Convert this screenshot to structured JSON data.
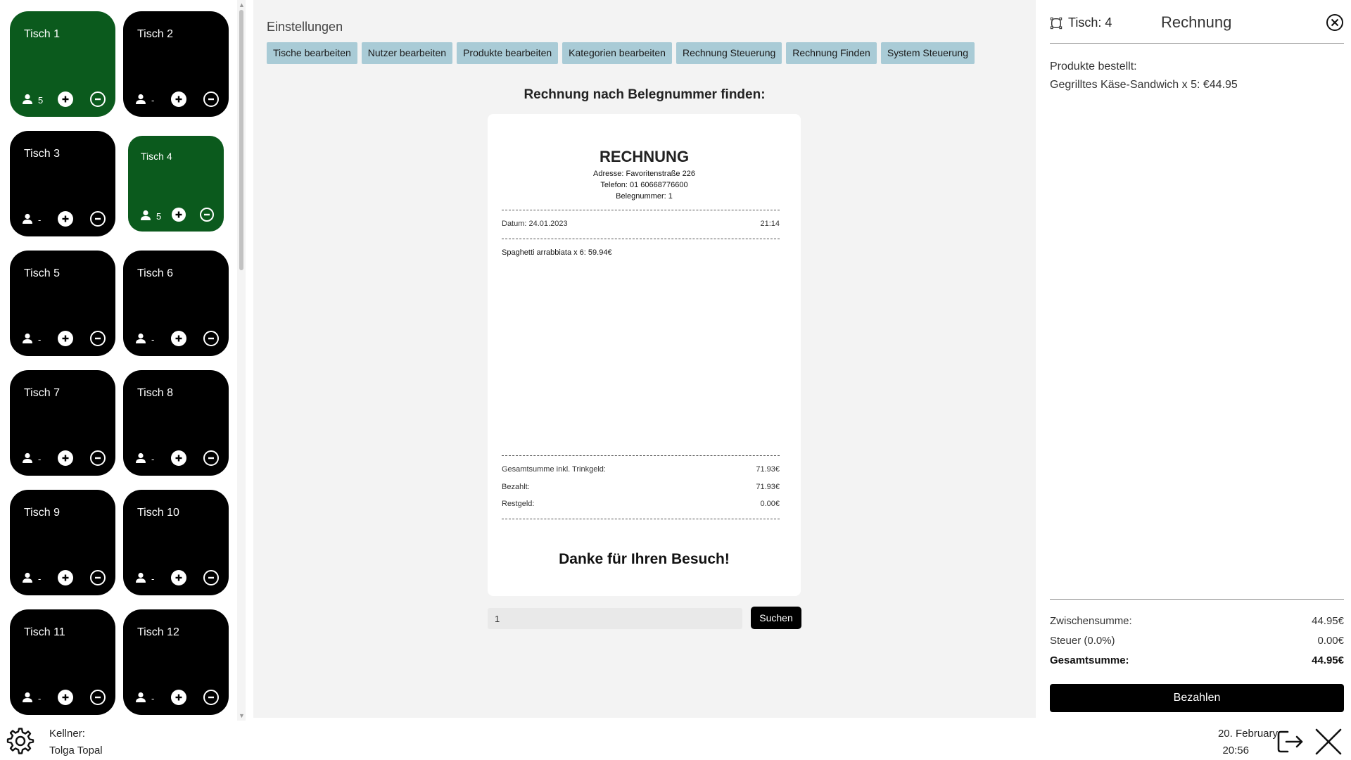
{
  "tables": [
    {
      "name": "Tisch 1",
      "guests": "5",
      "active": true,
      "selected": false
    },
    {
      "name": "Tisch 2",
      "guests": "-",
      "active": false,
      "selected": false
    },
    {
      "name": "Tisch 3",
      "guests": "-",
      "active": false,
      "selected": false
    },
    {
      "name": "Tisch 4",
      "guests": "5",
      "active": true,
      "selected": true
    },
    {
      "name": "Tisch 5",
      "guests": "-",
      "active": false,
      "selected": false
    },
    {
      "name": "Tisch 6",
      "guests": "-",
      "active": false,
      "selected": false
    },
    {
      "name": "Tisch 7",
      "guests": "-",
      "active": false,
      "selected": false
    },
    {
      "name": "Tisch 8",
      "guests": "-",
      "active": false,
      "selected": false
    },
    {
      "name": "Tisch 9",
      "guests": "-",
      "active": false,
      "selected": false
    },
    {
      "name": "Tisch 10",
      "guests": "-",
      "active": false,
      "selected": false
    },
    {
      "name": "Tisch 11",
      "guests": "-",
      "active": false,
      "selected": false
    },
    {
      "name": "Tisch 12",
      "guests": "-",
      "active": false,
      "selected": false
    }
  ],
  "colors": {
    "active_table": "#0b5a1d",
    "inactive_table": "#000000",
    "tab_background": "#a9cbd6"
  },
  "settings": {
    "title": "Einstellungen",
    "tabs": [
      "Tische bearbeiten",
      "Nutzer bearbeiten",
      "Produkte bearbeiten",
      "Kategorien bearbeiten",
      "Rechnung Steuerung",
      "Rechnung Finden",
      "System Steuerung"
    ]
  },
  "finder": {
    "heading": "Rechnung nach Belegnummer finden:",
    "search_value": "1",
    "search_button": "Suchen"
  },
  "receipt": {
    "title": "RECHNUNG",
    "address": "Adresse: Favoritenstraße 226",
    "phone": "Telefon: 01 60668776600",
    "receipt_number": "Belegnummer: 1",
    "date": "Datum: 24.01.2023",
    "time": "21:14",
    "items": [
      "Spaghetti arrabbiata x 6: 59.94€"
    ],
    "total_label": "Gesamtsumme inkl. Trinkgeld:",
    "total_value": "71.93€",
    "paid_label": "Bezahlt:",
    "paid_value": "71.93€",
    "change_label": "Restgeld:",
    "change_value": "0.00€",
    "thanks": "Danke für Ihren Besuch!"
  },
  "bill": {
    "table_label": "Tisch: 4",
    "title": "Rechnung",
    "products_label": "Produkte bestellt:",
    "products": [
      "Gegrilltes Käse-Sandwich x 5: €44.95"
    ],
    "subtotal_label": "Zwischensumme:",
    "subtotal_value": "44.95€",
    "tax_label": "Steuer (0.0%)",
    "tax_value": "0.00€",
    "total_label": "Gesamtsumme:",
    "total_value": "44.95€",
    "pay_button": "Bezahlen"
  },
  "footer": {
    "waiter_label": "Kellner:",
    "waiter_name": "Tolga Topal",
    "date": "20. February",
    "time": "20:56",
    "icons": [
      "gear-icon",
      "logout-icon",
      "close-app-icon"
    ]
  }
}
